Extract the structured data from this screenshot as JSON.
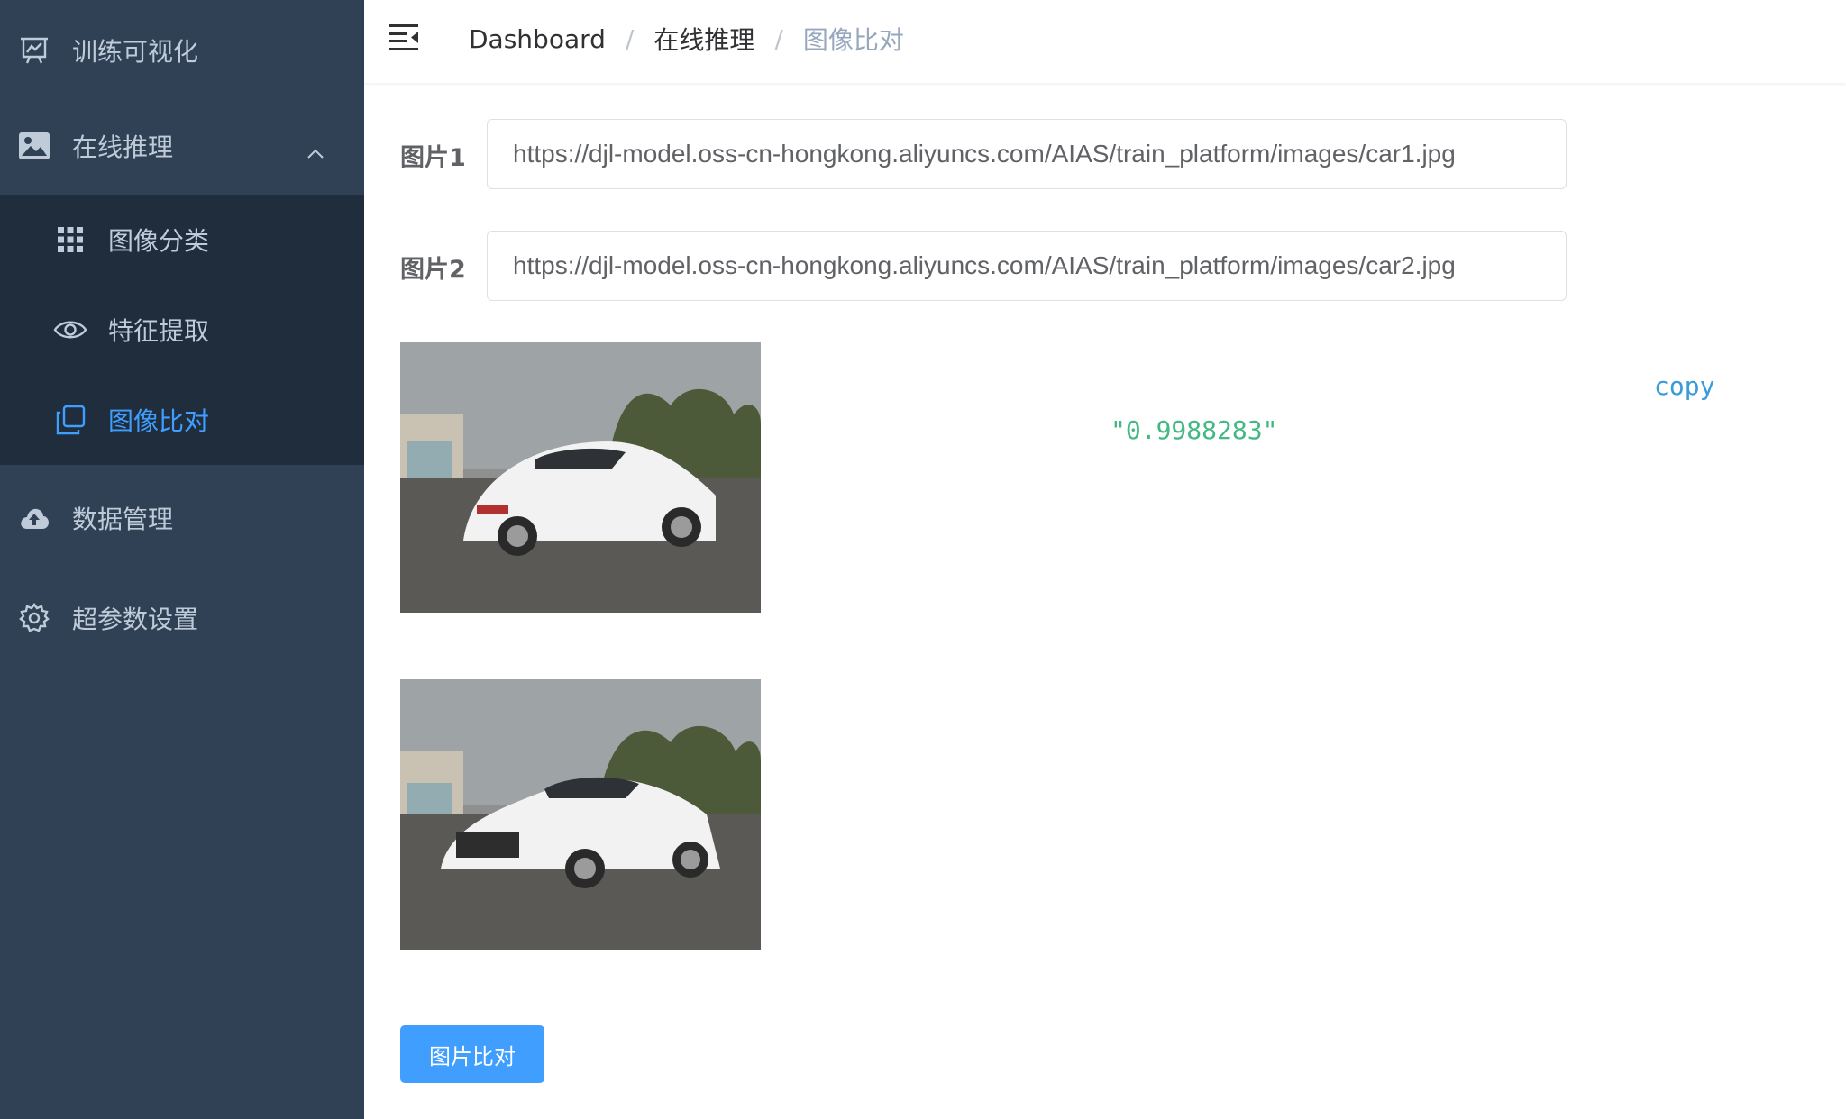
{
  "sidebar": {
    "items": [
      {
        "label": "训练可视化",
        "icon": "presentation-chart-icon"
      },
      {
        "label": "在线推理",
        "icon": "image-icon",
        "expanded": true
      },
      {
        "label": "数据管理",
        "icon": "cloud-upload-icon"
      },
      {
        "label": "超参数设置",
        "icon": "gear-icon"
      }
    ],
    "submenu": [
      {
        "label": "图像分类",
        "icon": "grid-icon"
      },
      {
        "label": "特征提取",
        "icon": "eye-icon"
      },
      {
        "label": "图像比对",
        "icon": "copy-squares-icon",
        "active": true
      }
    ]
  },
  "breadcrumb": {
    "home": "Dashboard",
    "sep": "/",
    "parent": "在线推理",
    "current": "图像比对"
  },
  "form": {
    "image1_label": "图片1",
    "image1_url": "https://djl-model.oss-cn-hongkong.aliyuncs.com/AIAS/train_platform/images/car1.jpg",
    "image2_label": "图片2",
    "image2_url": "https://djl-model.oss-cn-hongkong.aliyuncs.com/AIAS/train_platform/images/car2.jpg"
  },
  "result": {
    "copy_label": "copy",
    "value": "\"0.9988283\""
  },
  "button": {
    "compare_label": "图片比对"
  },
  "colors": {
    "sidebar_bg": "#304156",
    "submenu_bg": "#1f2d3d",
    "active": "#409eff",
    "result": "#42b983"
  }
}
